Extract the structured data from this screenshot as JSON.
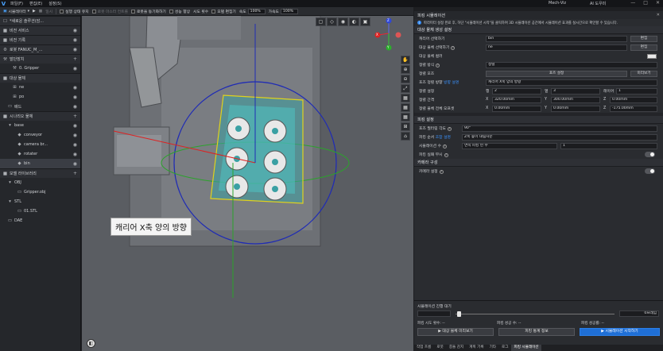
{
  "titlebar": {
    "logo": "V",
    "menu": [
      "파일(F)",
      "편집(E)",
      "설정(S)"
    ],
    "app_title": "Mech-Viz",
    "ai_assistant": "AI 도우미",
    "win": [
      "—",
      "□",
      "✕"
    ]
  },
  "toolbar": {
    "simulator": "시뮬레이터",
    "play": "▶",
    "stop": "■",
    "pause": "일시",
    "keep_running": "실행 상태 유지",
    "robot_master": "로봇 마스터 컨트롤",
    "robot_sync": "로봇을 동기화하기",
    "sensor_space": "성능 향상",
    "speed_count": "시도 횟수",
    "model_edit": "모델 편집기",
    "speed_label": "속도",
    "speed_value": "100%",
    "accel_label": "가속도",
    "accel_value": "100%"
  },
  "leftpanel": {
    "rows": [
      {
        "icon": "☐",
        "label": "*새로운 솔루션(암...",
        "section": true
      },
      {
        "icon": "■",
        "label": "비전 서비스",
        "section": true
      },
      {
        "icon": "■",
        "label": "비전 기록",
        "section": true
      },
      {
        "icon": "⚙",
        "label": "로봇 FANUC_M_...",
        "section": true
      },
      {
        "icon": "⚒",
        "label": "말단장치",
        "section": true
      },
      {
        "icon": "⚒",
        "label": "0. Gripper",
        "indent": 2
      },
      {
        "icon": "■",
        "label": "대상 물체",
        "section": true
      },
      {
        "icon": "⊞",
        "label": "ne",
        "indent": 2
      },
      {
        "icon": "⊞",
        "label": "po",
        "indent": 2
      },
      {
        "icon": "▭",
        "label": "배드",
        "indent": 1
      },
      {
        "icon": "■",
        "label": "시나리오 물체",
        "section": true
      },
      {
        "icon": "▾",
        "label": "base",
        "indent": 1
      },
      {
        "icon": "◆",
        "label": "conveyor",
        "indent": 3
      },
      {
        "icon": "◆",
        "label": "camera br...",
        "indent": 3
      },
      {
        "icon": "◆",
        "label": "rotater",
        "indent": 3
      },
      {
        "icon": "◆",
        "label": "bin",
        "indent": 3,
        "selected": true
      },
      {
        "icon": "■",
        "label": "모델 라이브러리",
        "section": true
      },
      {
        "icon": "▾",
        "label": "OBJ",
        "indent": 1
      },
      {
        "icon": "▭",
        "label": "Gripper.obj",
        "indent": 3
      },
      {
        "icon": "▾",
        "label": "STL",
        "indent": 1
      },
      {
        "icon": "▭",
        "label": "01.STL",
        "indent": 3
      },
      {
        "icon": "▭",
        "label": "DAE",
        "indent": 1
      }
    ],
    "add": "+",
    "eye": "◉"
  },
  "viewport": {
    "tooltip": "캐리어 X축 양의 방향",
    "axis_x": "X",
    "axis_y": "Y",
    "axis_z": "Z",
    "top_tools": [
      "▢",
      "◇",
      "◉",
      "◐",
      "▣"
    ],
    "side_tools": [
      "✋",
      "⊕",
      "⊖",
      "⤢",
      "▦",
      "▦",
      "▦",
      "⊞",
      "⌂"
    ],
    "bottom_icon": "◧"
  },
  "rightpanel": {
    "title": "피킹 시뮬레이션",
    "close": "✕",
    "info": "파라미터 설정 완료 후, 하단 \"시뮬레이션 시작\"을 클릭하여 3D 시뮬레이션 공간에서 시뮬레이션 효과를 실시간으로 확인할 수 있습니다.",
    "sec_target": "대상 물체 생성 설정",
    "carrier_label": "캐리어 선택하기",
    "carrier_value": "bin",
    "edit": "편집",
    "target_label": "대상 물체 선택하기",
    "target_value": "ne",
    "color_label": "대상 물체 컬러",
    "place_label": "정렬 방식",
    "place_value": "정렬",
    "pose_label": "정렬 포즈",
    "pose_button": "포즈 설정",
    "preview": "미리보기",
    "pose_dir_label": "포즈 정렬 방향",
    "pose_dir_link": "방향 설명",
    "pose_dir_value": "캐리어 X축 양의 방향",
    "count_label": "정렬 설정",
    "row_label": "행",
    "row_value": "2",
    "col_label": "열",
    "col_value": "3",
    "layer_label": "레이어",
    "layer_value": "1",
    "spacing_label": "정렬 간격",
    "sx": "320.00mm",
    "sy": "300.00mm",
    "sz": "0.00mm",
    "offset_label": "정렬 물체 전체 오프셋",
    "ox": "0.00mm",
    "oy": "0.00mm",
    "oz": "-175.00mm",
    "sec_pick": "피킹 설정",
    "pose_filter_label": "포즈 필터링 각도",
    "pose_filter_value": "90°",
    "pick_order_label": "피킹 순서",
    "pick_order_link": "조합 설명",
    "pick_order_value": "Z축 높이 내림차순",
    "sim_count_label": "시뮬레이션 수",
    "sim_count_mode": "연속 피킹 빈 수",
    "sim_count_value": "1",
    "pick_fail_label": "피킹 실패 무시",
    "sec_camera": "카메라 구성",
    "camera_label": "카메라 설정",
    "sim_progress_label": "시뮬레이션 진행 대기",
    "frames": "0프레임",
    "pick_tries": "피킹 시도 횟수: --",
    "pick_success": "피킹 성공 수: --",
    "pick_rate": "피킹 성공률: --",
    "btn_preview": "대상 물체 미리보기",
    "btn_stats": "피킹 통계 정보",
    "btn_start": "▶ 시뮬레이션 시작하기",
    "tabs": [
      "작업 흐름",
      "로봇",
      "충돌 감지",
      "계획 기록",
      "기타",
      "로그",
      "피킹 시뮬레이션"
    ]
  }
}
